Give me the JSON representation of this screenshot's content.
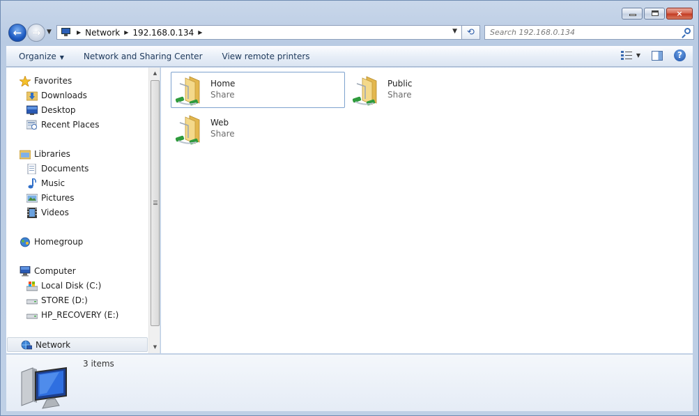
{
  "window": {
    "caption_buttons": {
      "minimize": "minimize",
      "maximize": "maximize",
      "close": "×"
    }
  },
  "navigation": {
    "back_label": "←",
    "forward_label": "→",
    "breadcrumb": [
      "Network",
      "192.168.0.134"
    ],
    "search_placeholder": "Search 192.168.0.134"
  },
  "command_bar": {
    "organize": "Organize",
    "items": [
      "Network and Sharing Center",
      "View remote printers"
    ],
    "help": "?"
  },
  "nav_pane": {
    "favorites": {
      "label": "Favorites",
      "items": [
        "Downloads",
        "Desktop",
        "Recent Places"
      ]
    },
    "libraries": {
      "label": "Libraries",
      "items": [
        "Documents",
        "Music",
        "Pictures",
        "Videos"
      ]
    },
    "homegroup": {
      "label": "Homegroup"
    },
    "computer": {
      "label": "Computer",
      "items": [
        "Local Disk (C:)",
        "STORE (D:)",
        "HP_RECOVERY (E:)"
      ]
    },
    "network": {
      "label": "Network"
    }
  },
  "content": {
    "shares": [
      {
        "name": "Home",
        "type": "Share"
      },
      {
        "name": "Public",
        "type": "Share"
      },
      {
        "name": "Web",
        "type": "Share"
      }
    ]
  },
  "details": {
    "count": "3 items"
  },
  "colors": {
    "accent": "#1d5bc2",
    "folder": "#f2d27a",
    "link": "#1e395b"
  }
}
